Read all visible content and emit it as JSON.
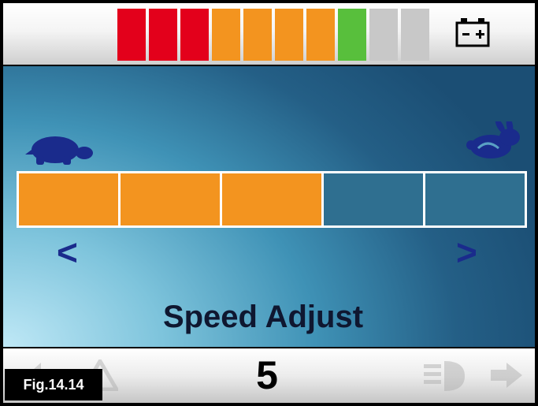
{
  "battery": {
    "segments": [
      "#e3001b",
      "#e3001b",
      "#e3001b",
      "#f3941f",
      "#f3941f",
      "#f3941f",
      "#f3941f",
      "#58bf3c",
      "#c8c8c8",
      "#c8c8c8"
    ],
    "icon": "battery-icon"
  },
  "speed": {
    "level_segments": 5,
    "active_segments": 3,
    "slow_icon": "turtle-icon",
    "fast_icon": "rabbit-icon",
    "decrease_label": "<",
    "increase_label": ">",
    "active_color": "#f3941f",
    "inactive_color": "#2f6f90"
  },
  "mode_title": "Speed Adjust",
  "profile_number": "5",
  "figure_label": "Fig.14.14",
  "bottom_icons": [
    "left-arrow-icon",
    "hazard-icon",
    "headlight-icon",
    "right-arrow-icon"
  ]
}
